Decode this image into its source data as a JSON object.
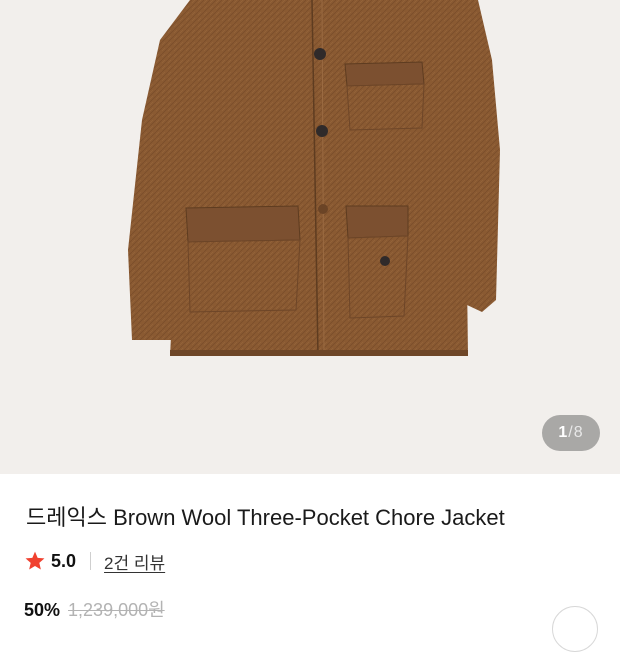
{
  "gallery": {
    "image_name": "brown-wool-chore-jacket-photo",
    "current": "1",
    "separator": "/",
    "total": "8"
  },
  "product": {
    "title": "드레익스 Brown Wool Three-Pocket Chore Jacket",
    "rating": "5.0",
    "review_count": "2건 리뷰",
    "discount": "50%",
    "original_price": "1,239,000원"
  },
  "colors": {
    "rating_star": "#f0412f",
    "jacket": "#8a5a32",
    "background": "#f2efec"
  },
  "icons": {
    "rating": "star-icon"
  }
}
